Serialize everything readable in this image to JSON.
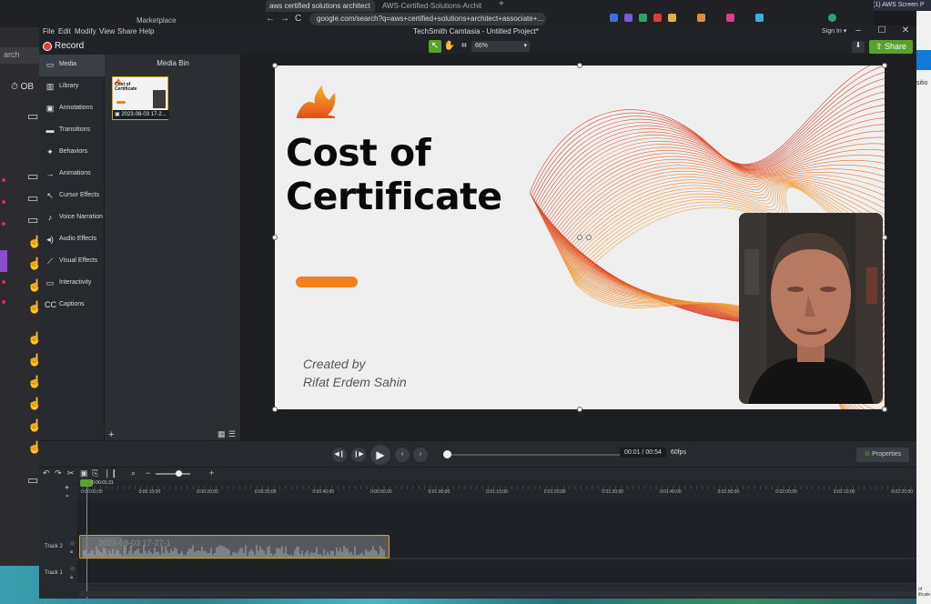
{
  "browser": {
    "tab1": "aws certified solutions architect",
    "tab2": "AWS-Certified-Solutions-Archit",
    "plus": "+",
    "url": "google.com/search?q=aws+certified+solutions+architect+associate+...",
    "back": "←",
    "forward": "→",
    "reload": "C"
  },
  "desktop": {
    "search_text": "arch",
    "left_label": "OB",
    "marketplace": "Marketplace",
    "right_top": "(1) AWS Screen P",
    "right_side_text": "sitio",
    "corner_text": "of\nificate"
  },
  "menubar": {
    "items": [
      "File",
      "Edit",
      "Modify",
      "View",
      "Share",
      "Help"
    ],
    "title": "TechSmith Camtasia - Untitled Project*",
    "sign_in": "Sign In ▾",
    "minimize": "–",
    "maximize": "☐",
    "close": "✕"
  },
  "toolbar": {
    "record": "Record",
    "zoom": "66%",
    "share": "Share",
    "colors": {
      "accent": "#5aa02c",
      "record": "#e23b3b"
    }
  },
  "sidebar": {
    "items": [
      {
        "label": "Media",
        "icon": "media-icon",
        "glyph": "▭"
      },
      {
        "label": "Library",
        "icon": "library-icon",
        "glyph": "▥"
      },
      {
        "label": "Annotations",
        "icon": "annotations-icon",
        "glyph": "▣"
      },
      {
        "label": "Transitions",
        "icon": "transitions-icon",
        "glyph": "▬"
      },
      {
        "label": "Behaviors",
        "icon": "behaviors-icon",
        "glyph": "✦"
      },
      {
        "label": "Animations",
        "icon": "animations-icon",
        "glyph": "→"
      },
      {
        "label": "Cursor Effects",
        "icon": "cursor-effects-icon",
        "glyph": "↖"
      },
      {
        "label": "Voice Narration",
        "icon": "microphone-icon",
        "glyph": "♪"
      },
      {
        "label": "Audio Effects",
        "icon": "audio-effects-icon",
        "glyph": "◂)"
      },
      {
        "label": "Visual Effects",
        "icon": "visual-effects-icon",
        "glyph": "⟋"
      },
      {
        "label": "Interactivity",
        "icon": "interactivity-icon",
        "glyph": "▭"
      },
      {
        "label": "Captions",
        "icon": "captions-icon",
        "glyph": "CC"
      }
    ]
  },
  "media_bin": {
    "title": "Media Bin",
    "thumb_title": "Cost of Certificate",
    "thumb_label": "2023-08-03 17-2...",
    "add": "+"
  },
  "slide": {
    "title_line1": "Cost of",
    "title_line2": "Certificate",
    "credit_line1": "Created by",
    "credit_line2": "Rifat Erdem Sahin",
    "colors": {
      "bar": "#f0821e",
      "wave_start": "#d93a2a",
      "wave_end": "#f2a63a"
    }
  },
  "playback": {
    "time": "00:01 / 00:54",
    "fps": "60fps",
    "properties": "Properties"
  },
  "timeline": {
    "playhead_time": "0:00:01;31",
    "ticks": [
      "0:00:00;00",
      "0:00:10;00",
      "0:00:20;00",
      "0:00:30;00",
      "0:00:40;00",
      "0:00:50;00",
      "0:01:00;00",
      "0:01:10;00",
      "0:01:20;00",
      "0:01:30;00",
      "0:01:40;00",
      "0:01:50;00",
      "0:02:00;00",
      "0:02:10;00",
      "0:02:20;00"
    ],
    "tracks": [
      {
        "label": "Track 2"
      },
      {
        "label": "Track 1"
      }
    ],
    "clip_label": "2023-08-03 17-27-1"
  }
}
